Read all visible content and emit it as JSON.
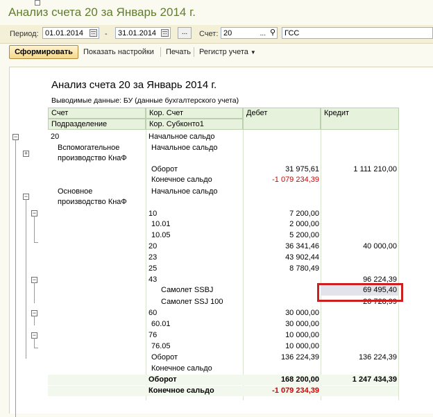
{
  "window": {
    "title": "Анализ счета 20 за Январь 2014 г."
  },
  "params": {
    "period_label": "Период:",
    "date_from": "01.01.2014",
    "dash": "-",
    "date_to": "31.01.2014",
    "dots_label": "...",
    "account_label": "Счет:",
    "account_value": "20",
    "org_value": "ГСС"
  },
  "toolbar": {
    "generate": "Сформировать",
    "settings": "Показать настройки",
    "print": "Печать",
    "register": "Регистр учета"
  },
  "report": {
    "title": "Анализ счета 20 за Январь 2014 г.",
    "output_data": "Выводимые данные:  БУ (данные бухгалтерского учета)",
    "headers": {
      "col1_top": "Счет",
      "col1_bottom": "Подразделение",
      "col2_top": "Кор. Счет",
      "col2_bottom": "Кор. Субконто1",
      "col3": "Дебет",
      "col4": "Кредит"
    },
    "rows": [
      {
        "c1": "20",
        "c2": "Начальное сальдо",
        "c3": "",
        "c4": ""
      },
      {
        "c1": "Вспомогательное",
        "c2": "Начальное сальдо",
        "c3": "",
        "c4": ""
      },
      {
        "c1": "производство КнаФ",
        "c2": "",
        "c3": "",
        "c4": ""
      },
      {
        "c1": "",
        "c2": "Оборот",
        "c3": "31 975,61",
        "c4": "1 111 210,00"
      },
      {
        "c1": "",
        "c2": "Конечное сальдо",
        "c3": "-1 079 234,39",
        "c4": ""
      },
      {
        "c1": "Основное",
        "c2": "Начальное сальдо",
        "c3": "",
        "c4": ""
      },
      {
        "c1": "производство КнаФ",
        "c2": "",
        "c3": "",
        "c4": ""
      },
      {
        "c1": "",
        "c2": "10",
        "c3": "7 200,00",
        "c4": ""
      },
      {
        "c1": "",
        "c2": "10.01",
        "c3": "2 000,00",
        "c4": ""
      },
      {
        "c1": "",
        "c2": "10.05",
        "c3": "5 200,00",
        "c4": ""
      },
      {
        "c1": "",
        "c2": "20",
        "c3": "36 341,46",
        "c4": "40 000,00"
      },
      {
        "c1": "",
        "c2": "23",
        "c3": "43 902,44",
        "c4": ""
      },
      {
        "c1": "",
        "c2": "25",
        "c3": "8 780,49",
        "c4": ""
      },
      {
        "c1": "",
        "c2": "43",
        "c3": "",
        "c4": "96 224,39"
      },
      {
        "c1": "",
        "c2": "Самолет SSBJ",
        "c3": "",
        "c4": "69 495,40"
      },
      {
        "c1": "",
        "c2": "Самолет SSJ 100",
        "c3": "",
        "c4": "26 728,99"
      },
      {
        "c1": "",
        "c2": "60",
        "c3": "30 000,00",
        "c4": ""
      },
      {
        "c1": "",
        "c2": "60.01",
        "c3": "30 000,00",
        "c4": ""
      },
      {
        "c1": "",
        "c2": "76",
        "c3": "10 000,00",
        "c4": ""
      },
      {
        "c1": "",
        "c2": "76.05",
        "c3": "10 000,00",
        "c4": ""
      },
      {
        "c1": "",
        "c2": "Оборот",
        "c3": "136 224,39",
        "c4": "136 224,39"
      },
      {
        "c1": "",
        "c2": "Конечное сальдо",
        "c3": "",
        "c4": ""
      },
      {
        "c1": "",
        "c2": "Оборот",
        "c3": "168 200,00",
        "c4": "1 247 434,39"
      },
      {
        "c1": "",
        "c2": "Конечное сальдо",
        "c3": "-1 079 234,39",
        "c4": ""
      }
    ]
  },
  "colors": {
    "title_green": "#5f7d2c",
    "header_bg": "#e7f2dc",
    "negative": "#d00000",
    "highlight_border": "#cc1f1f"
  }
}
